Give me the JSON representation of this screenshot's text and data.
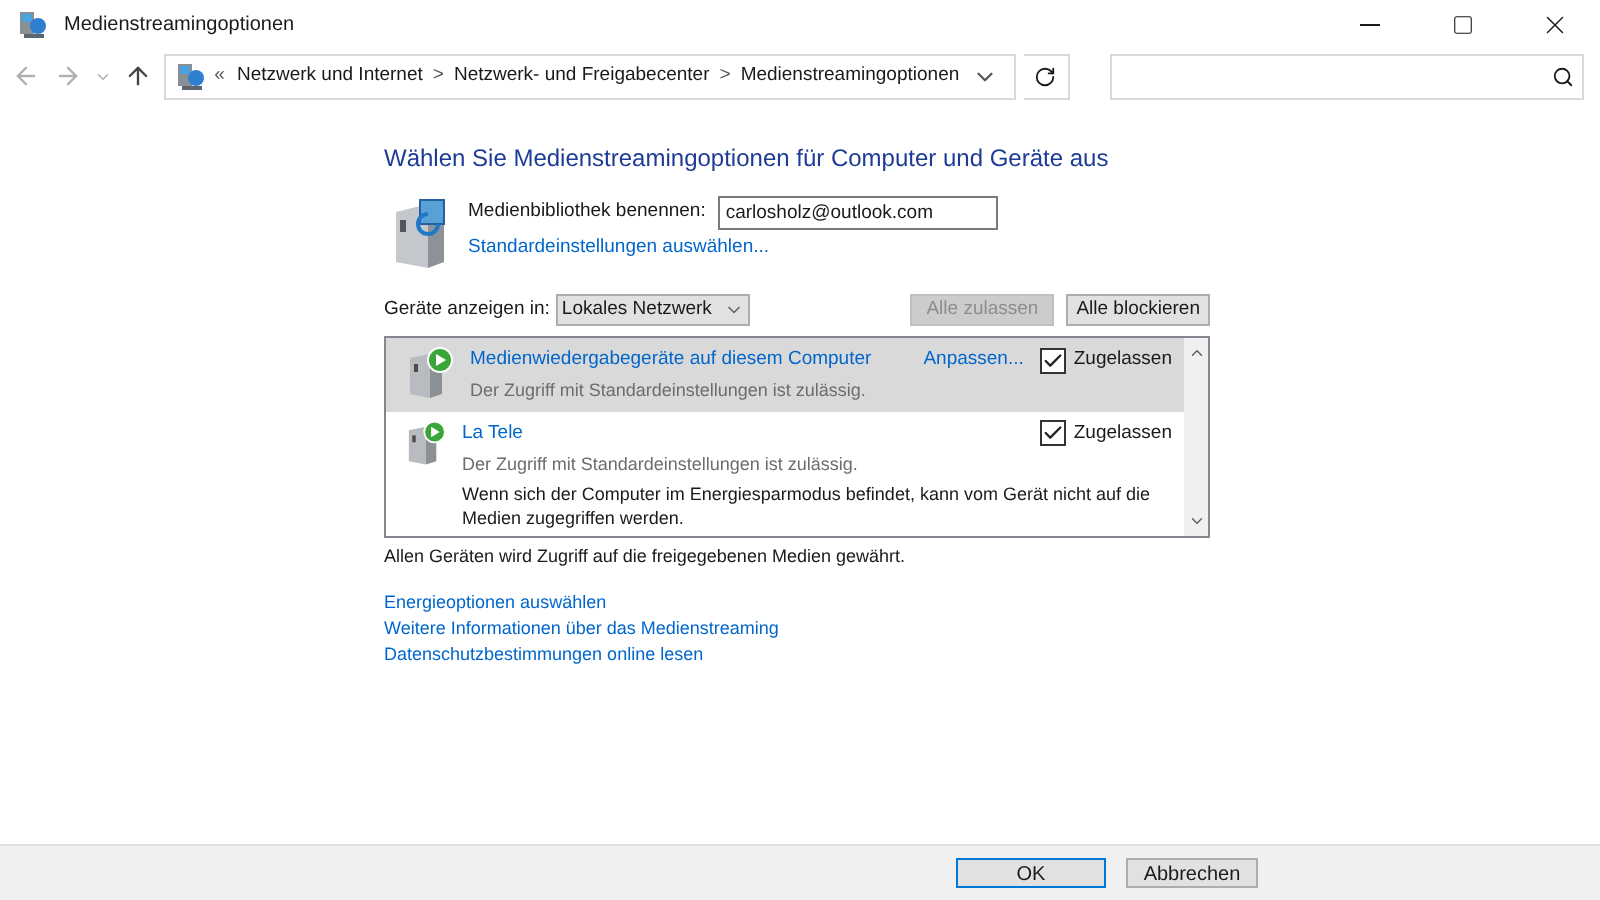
{
  "window": {
    "title": "Medienstreamingoptionen"
  },
  "address_bar": {
    "overflow": "«",
    "breadcrumbs": [
      "Netzwerk und Internet",
      "Netzwerk- und Freigabecenter",
      "Medienstreamingoptionen"
    ],
    "separator": ">"
  },
  "heading": "Wählen Sie Medienstreamingoptionen für Computer und Geräte aus",
  "library": {
    "label": "Medienbibliothek benennen:",
    "value": "carlosholz@outlook.com",
    "defaults_link": "Standardeinstellungen auswählen..."
  },
  "filter": {
    "label": "Geräte anzeigen in:",
    "value": "Lokales Netzwerk"
  },
  "allow_all": {
    "label": "Alle zulassen",
    "disabled": true
  },
  "block_all": {
    "label": "Alle blockieren",
    "disabled": false
  },
  "devices": [
    {
      "name": "Medienwiedergabegeräte auf diesem Computer",
      "status": "Der Zugriff mit Standardeinstellungen ist zulässig.",
      "customize": "Anpassen...",
      "allowed_label": "Zugelassen",
      "allowed": true,
      "selected": true
    },
    {
      "name": "La Tele",
      "status": "Der Zugriff mit Standardeinstellungen ist zulässig.",
      "note": "Wenn sich der Computer im Energiesparmodus befindet, kann vom Gerät nicht auf die Medien zugegriffen werden.",
      "allowed_label": "Zugelassen",
      "allowed": true,
      "selected": false
    }
  ],
  "summary": "Allen Geräten wird Zugriff auf die freigegebenen Medien gewährt.",
  "links": [
    "Energieoptionen auswählen",
    "Weitere Informationen über das Medienstreaming",
    "Datenschutzbestimmungen online lesen"
  ],
  "buttons": [
    {
      "label": "OK",
      "default": true
    },
    {
      "label": "Abbrechen",
      "default": false
    }
  ]
}
